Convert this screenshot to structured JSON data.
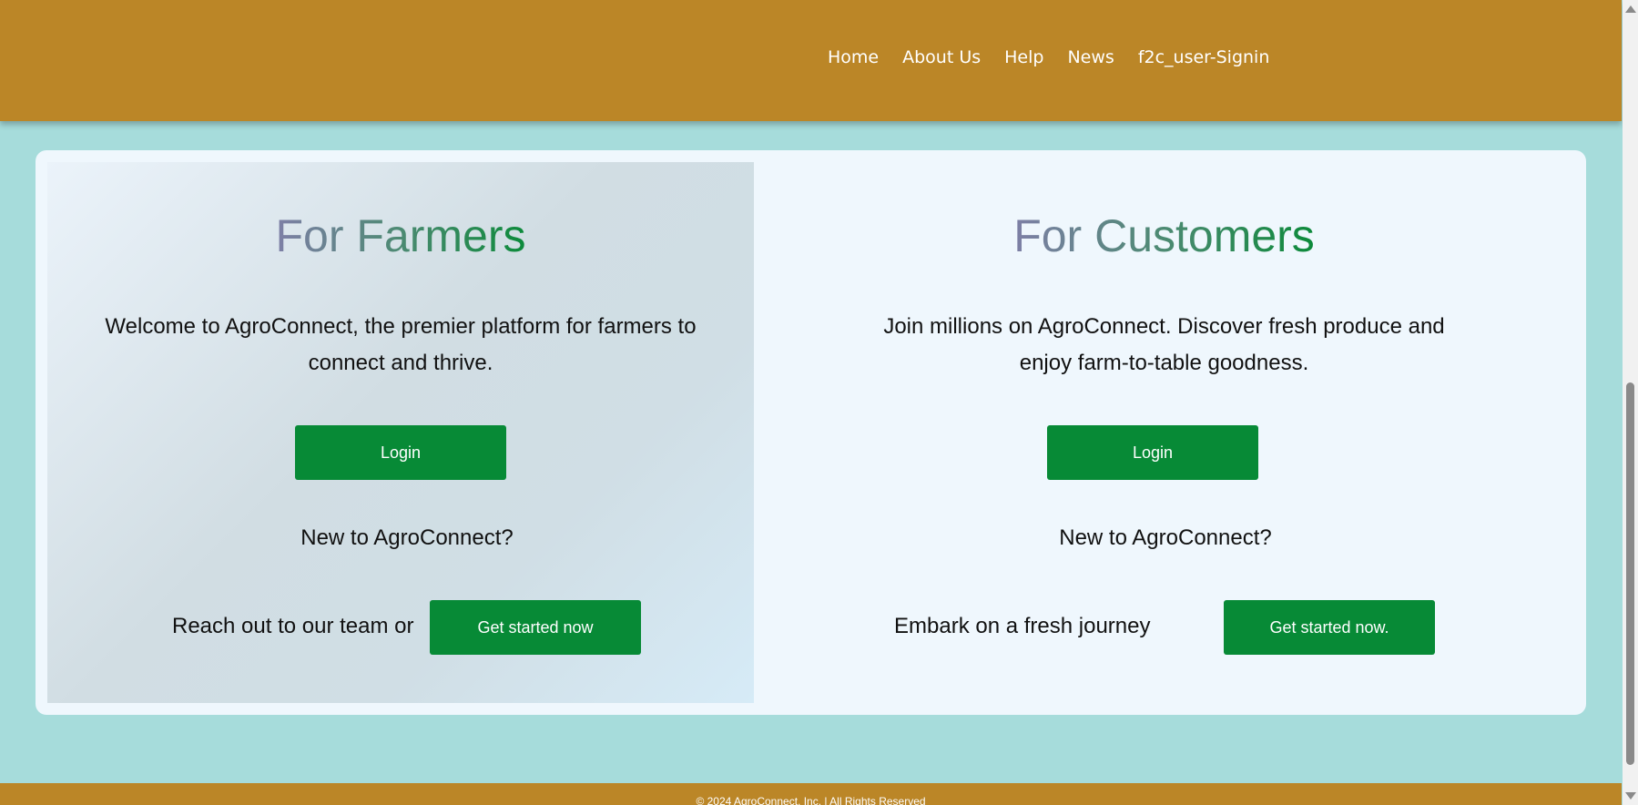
{
  "nav": {
    "items": [
      {
        "label": "Home"
      },
      {
        "label": "About Us"
      },
      {
        "label": "Help"
      },
      {
        "label": "News"
      },
      {
        "label": "f2c_user-Signin"
      }
    ]
  },
  "farmers": {
    "title": "For Farmers",
    "description": "Welcome to AgroConnect, the premier platform for farmers to connect and thrive.",
    "login_label": "Login",
    "new_to": "New to AgroConnect?",
    "cta_text": "Reach out to our team or",
    "cta_button": "Get started now"
  },
  "customers": {
    "title": "For Customers",
    "description": "Join millions on AgroConnect. Discover fresh produce and enjoy farm-to-table goodness.",
    "login_label": "Login",
    "new_to": "New to AgroConnect?",
    "cta_text": "Embark on a fresh journey",
    "cta_button": "Get started now."
  },
  "footer": {
    "text": "© 2024 AgroConnect, Inc. | All Rights Reserved"
  },
  "colors": {
    "header": "#bb8627",
    "background": "#a6dcdb",
    "button": "#078a36",
    "card": "#eff7fd"
  }
}
